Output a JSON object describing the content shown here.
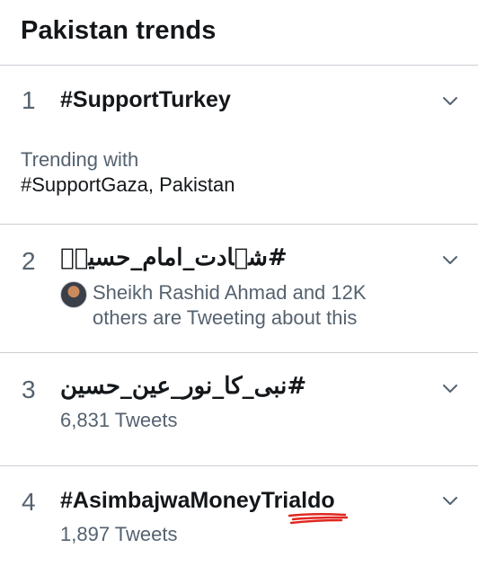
{
  "header": {
    "title": "Pakistan trends"
  },
  "trends": [
    {
      "rank": "1",
      "name": "#SupportTurkey",
      "context_label": "Trending with",
      "context_tags": "#SupportGaza, Pakistan"
    },
    {
      "rank": "2",
      "name": "#شہادت_امام_حسینؑ",
      "participants_line1": "Sheikh Rashid Ahmad and 12K",
      "participants_line2": "others are Tweeting about this"
    },
    {
      "rank": "3",
      "name": "#نبی_کا_نور_عین_حسین",
      "tweet_count": "6,831 Tweets"
    },
    {
      "rank": "4",
      "name": "#AsimbajwaMoneyTrialdo",
      "tweet_count": "1,897 Tweets"
    }
  ],
  "icons": {
    "chevron": "chevron-down-icon",
    "avatar": "avatar"
  },
  "colors": {
    "primary_text": "#14171a",
    "secondary_text": "#55626f",
    "divider": "#c9ced3",
    "annotation_red": "#e0261f"
  }
}
